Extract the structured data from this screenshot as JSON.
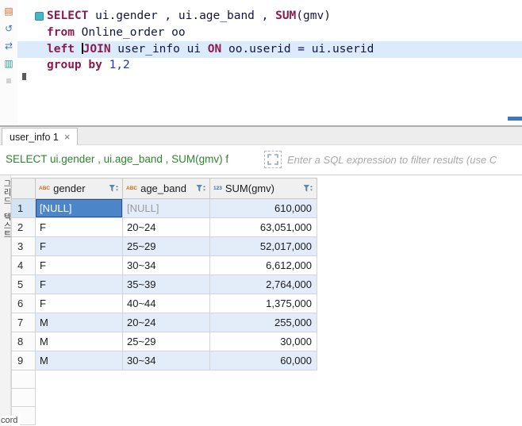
{
  "editor": {
    "toolbar_icons": [
      {
        "name": "execute-sql-icon",
        "glyph": "▤",
        "color": "#cf6a2d"
      },
      {
        "name": "execute-script-icon",
        "glyph": "↺",
        "color": "#3a78c2"
      },
      {
        "name": "export-result-icon",
        "glyph": "⇄",
        "color": "#3a78c2"
      },
      {
        "name": "explain-plan-icon",
        "glyph": "▥",
        "color": "#2f9d8a"
      },
      {
        "name": "more-actions-icon",
        "glyph": "≡",
        "color": "#9a9a9a"
      }
    ],
    "lines": [
      {
        "segments": [
          {
            "text": "SELECT",
            "type": "kw"
          },
          {
            "text": " ui.gender , ui.age_band , ",
            "type": "plain"
          },
          {
            "text": "SUM",
            "type": "kw"
          },
          {
            "text": "(gmv)",
            "type": "plain"
          }
        ]
      },
      {
        "segments": [
          {
            "text": "from",
            "type": "kw"
          },
          {
            "text": " Online_order oo",
            "type": "plain"
          }
        ]
      },
      {
        "current": true,
        "segments": [
          {
            "text": "left ",
            "type": "kw"
          },
          {
            "text": "JOIN",
            "type": "kw",
            "cursor_before": true
          },
          {
            "text": " user_info ui ",
            "type": "plain"
          },
          {
            "text": "ON",
            "type": "kw"
          },
          {
            "text": " oo.userid = ui.userid",
            "type": "plain"
          }
        ]
      },
      {
        "segments": [
          {
            "text": "group by",
            "type": "kw"
          },
          {
            "text": " ",
            "type": "plain"
          },
          {
            "text": "1,2",
            "type": "num"
          }
        ]
      }
    ]
  },
  "tab": {
    "label": "user_info 1",
    "close": "×"
  },
  "filter": {
    "query_label": "SELECT ui.gender , ui.age_band , SUM(gmv) f",
    "placeholder": "Enter a SQL expression to filter results (use C"
  },
  "grid": {
    "columns": [
      {
        "label": "gender",
        "type_icon": "ABC",
        "icon_color": "#d2691e"
      },
      {
        "label": "age_band",
        "type_icon": "ABC",
        "icon_color": "#d2691e"
      },
      {
        "label": "SUM(gmv)",
        "type_icon": "123",
        "icon_color": "#2e74b5"
      }
    ],
    "rows": [
      {
        "num": "1",
        "cells": [
          "[NULL]",
          "[NULL]",
          "610,000"
        ]
      },
      {
        "num": "2",
        "cells": [
          "F",
          "20~24",
          "63,051,000"
        ]
      },
      {
        "num": "3",
        "cells": [
          "F",
          "25~29",
          "52,017,000"
        ]
      },
      {
        "num": "4",
        "cells": [
          "F",
          "30~34",
          "6,612,000"
        ]
      },
      {
        "num": "5",
        "cells": [
          "F",
          "35~39",
          "2,764,000"
        ]
      },
      {
        "num": "6",
        "cells": [
          "F",
          "40~44",
          "1,375,000"
        ]
      },
      {
        "num": "7",
        "cells": [
          "M",
          "20~24",
          "255,000"
        ]
      },
      {
        "num": "8",
        "cells": [
          "M",
          "25~29",
          "30,000"
        ]
      },
      {
        "num": "9",
        "cells": [
          "M",
          "30~34",
          "60,000"
        ]
      }
    ],
    "selection": {
      "row": 0,
      "col": 0
    },
    "trailing_empty_rows": 3
  },
  "side": {
    "tabs": [
      "그리드",
      "텍스트"
    ],
    "record_partial": "cord"
  },
  "colors": {
    "keyword": "#8b1a4f",
    "number": "#2030c8",
    "filter_green": "#2d862d",
    "selection_blue": "#4c86c8",
    "row_alt": "#e3edf9"
  }
}
